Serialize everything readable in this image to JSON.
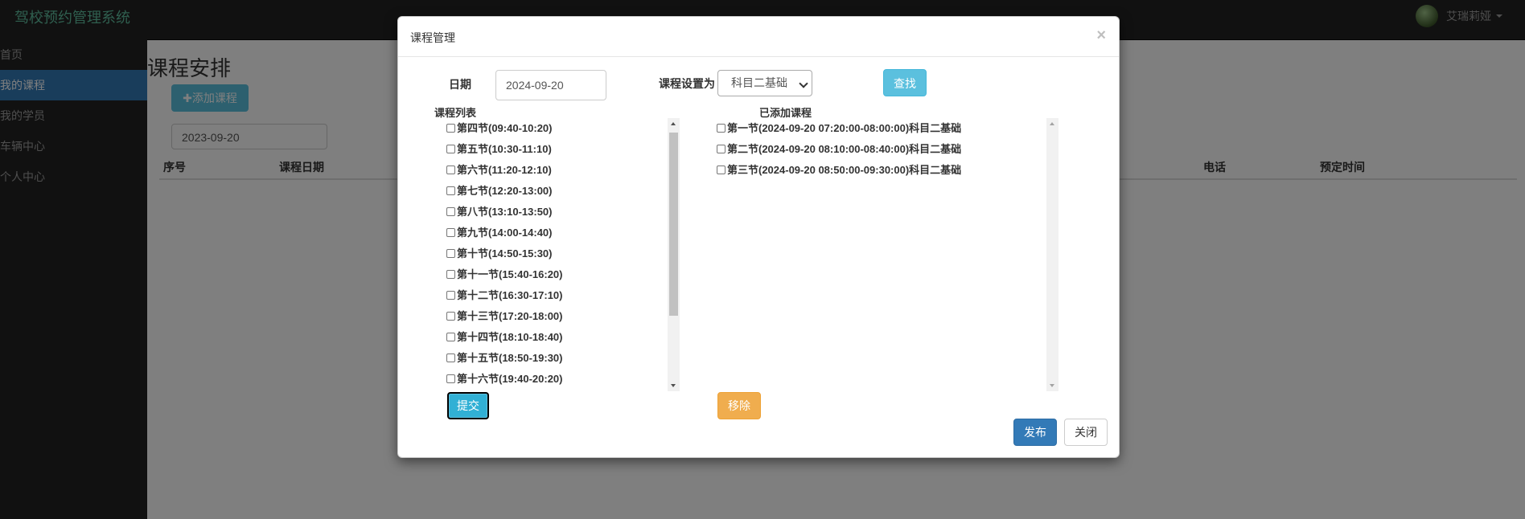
{
  "navbar": {
    "brand": "驾校预约管理系统",
    "user_name": "艾瑞莉娅"
  },
  "sidebar": {
    "items": [
      {
        "label": "首页",
        "active": false
      },
      {
        "label": "我的课程",
        "active": true
      },
      {
        "label": "我的学员",
        "active": false
      },
      {
        "label": "车辆中心",
        "active": false
      },
      {
        "label": "个人中心",
        "active": false
      }
    ]
  },
  "page": {
    "title": "课程安排",
    "add_button": "✚添加课程",
    "date_value": "2023-09-20",
    "table_headers": [
      "序号",
      "课程日期",
      "电话",
      "预定时间"
    ]
  },
  "modal": {
    "title": "课程管理",
    "close_symbol": "×",
    "date_label": "日期",
    "date_value": "2024-09-20",
    "course_setting_label": "课程设置为",
    "course_setting_value": "科目二基础",
    "find_button": "查找",
    "course_list_label": "课程列表",
    "added_label": "已添加课程",
    "course_list": [
      "第四节(09:40-10:20)",
      "第五节(10:30-11:10)",
      "第六节(11:20-12:10)",
      "第七节(12:20-13:00)",
      "第八节(13:10-13:50)",
      "第九节(14:00-14:40)",
      "第十节(14:50-15:30)",
      "第十一节(15:40-16:20)",
      "第十二节(16:30-17:10)",
      "第十三节(17:20-18:00)",
      "第十四节(18:10-18:40)",
      "第十五节(18:50-19:30)",
      "第十六节(19:40-20:20)"
    ],
    "added_list": [
      "第一节(2024-09-20 07:20:00-08:00:00)科目二基础",
      "第二节(2024-09-20 08:10:00-08:40:00)科目二基础",
      "第三节(2024-09-20 08:50:00-09:30:00)科目二基础"
    ],
    "submit_button": "提交",
    "remove_button": "移除",
    "publish_button": "发布",
    "close_button": "关闭"
  },
  "colors": {
    "primary": "#337ab7",
    "info": "#5bc0de",
    "warning": "#f0ad4e",
    "navbar": "#222222"
  }
}
